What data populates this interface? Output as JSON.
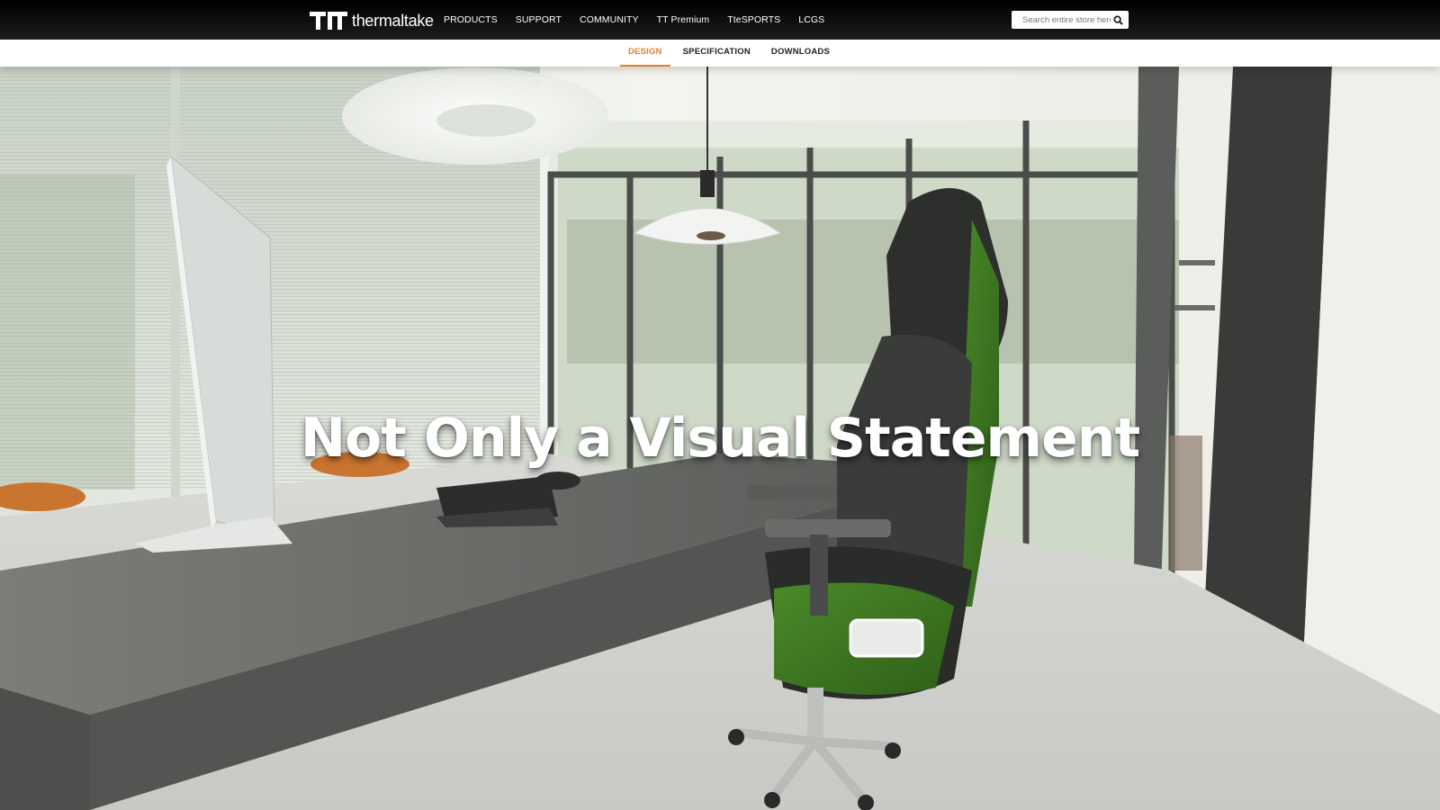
{
  "header": {
    "brand": "thermaltake",
    "nav": [
      {
        "label": "PRODUCTS"
      },
      {
        "label": "SUPPORT"
      },
      {
        "label": "COMMUNITY"
      },
      {
        "label": "TT Premium"
      },
      {
        "label": "TteSPORTS"
      },
      {
        "label": "LCGS"
      }
    ],
    "search": {
      "placeholder": "Search entire store here...",
      "value": "",
      "icon": "search-icon"
    }
  },
  "subnav": {
    "tabs": [
      {
        "label": "DESIGN",
        "active": true
      },
      {
        "label": "SPECIFICATION",
        "active": false
      },
      {
        "label": "DOWNLOADS",
        "active": false
      }
    ],
    "active_color": "#e67e22"
  },
  "hero": {
    "headline": "Not Only a Visual Statement",
    "image": "office-with-green-gaming-chair"
  }
}
